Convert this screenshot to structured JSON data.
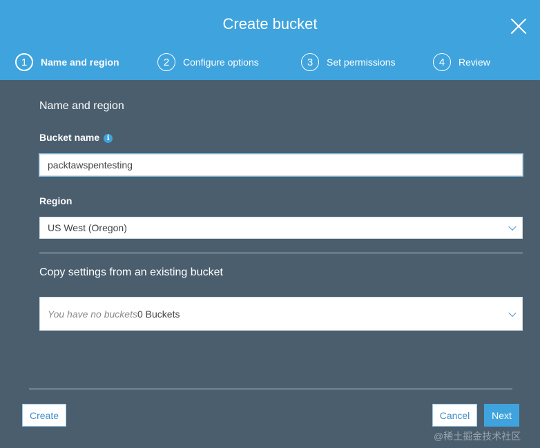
{
  "dialog": {
    "title": "Create bucket"
  },
  "steps": [
    {
      "number": "1",
      "label": "Name and region"
    },
    {
      "number": "2",
      "label": "Configure options"
    },
    {
      "number": "3",
      "label": "Set permissions"
    },
    {
      "number": "4",
      "label": "Review"
    }
  ],
  "form": {
    "section_title": "Name and region",
    "bucket_name_label": "Bucket name",
    "bucket_name_value": "packtawspentesting",
    "region_label": "Region",
    "region_value": "US West (Oregon)",
    "copy_title": "Copy settings from an existing bucket",
    "copy_placeholder": "You have no buckets",
    "copy_count": "0 Buckets"
  },
  "footer": {
    "create_label": "Create",
    "cancel_label": "Cancel",
    "next_label": "Next"
  },
  "watermark": "@稀土掘金技术社区",
  "colors": {
    "header": "#3fa3dd",
    "body": "#4b5e6e",
    "primary": "#3fa3dd"
  },
  "icons": {
    "close": "close-icon",
    "info": "info-icon",
    "dropdown": "chevron-down-icon"
  }
}
